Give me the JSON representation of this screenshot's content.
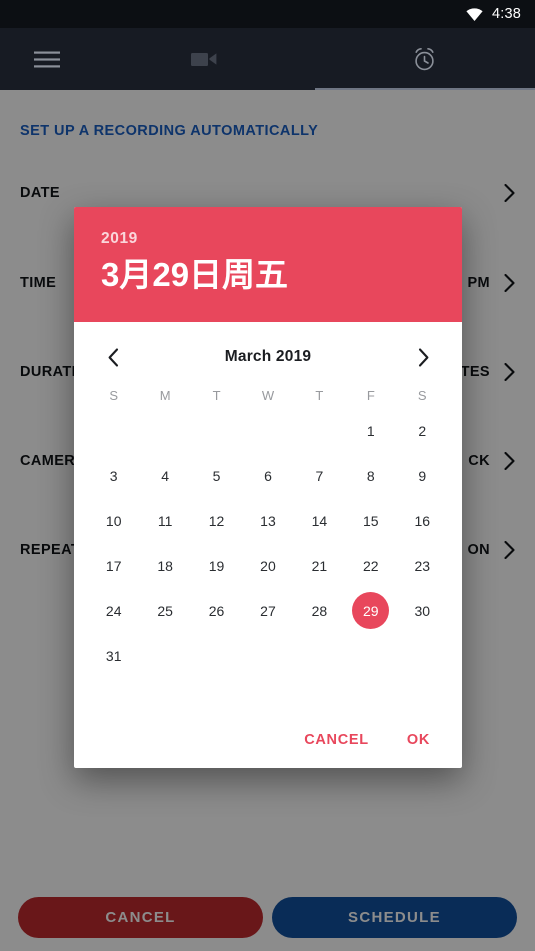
{
  "status_bar": {
    "time": "4:38",
    "wifi_icon": "wifi-icon"
  },
  "app_bar": {
    "menu_icon": "hamburger-menu-icon",
    "tabs": [
      {
        "icon": "video-camera-icon",
        "name": "tab-video",
        "active": false
      },
      {
        "icon": "alarm-clock-icon",
        "name": "tab-scheduler",
        "active": true
      }
    ]
  },
  "content": {
    "section_header": "SET UP A RECORDING AUTOMATICALLY",
    "rows": [
      {
        "label": "DATE",
        "value": "",
        "chevron": "chevron-right-icon"
      },
      {
        "label": "TIME",
        "value": "PM",
        "chevron": "chevron-right-icon"
      },
      {
        "label": "DURATION",
        "value": "TES",
        "chevron": "chevron-right-icon"
      },
      {
        "label": "CAMERA",
        "value": "CK",
        "chevron": "chevron-right-icon"
      },
      {
        "label": "REPEAT",
        "value": "ON",
        "chevron": "chevron-right-icon"
      }
    ],
    "bottom_buttons": {
      "cancel": "CANCEL",
      "schedule": "SCHEDULE"
    }
  },
  "dialog": {
    "header": {
      "year": "2019",
      "date_text": "3月29日周五"
    },
    "calendar": {
      "month_label": "March 2019",
      "prev_icon": "chevron-left-icon",
      "next_icon": "chevron-right-icon",
      "weekday_headers": [
        "S",
        "M",
        "T",
        "W",
        "T",
        "F",
        "S"
      ],
      "selected_day": 29,
      "weeks": [
        [
          "",
          "",
          "",
          "",
          "",
          "1",
          "2"
        ],
        [
          "3",
          "4",
          "5",
          "6",
          "7",
          "8",
          "9"
        ],
        [
          "10",
          "11",
          "12",
          "13",
          "14",
          "15",
          "16"
        ],
        [
          "17",
          "18",
          "19",
          "20",
          "21",
          "22",
          "23"
        ],
        [
          "24",
          "25",
          "26",
          "27",
          "28",
          "29",
          "30"
        ],
        [
          "31",
          "",
          "",
          "",
          "",
          "",
          ""
        ]
      ]
    },
    "actions": {
      "cancel": "CANCEL",
      "ok": "OK"
    }
  },
  "colors": {
    "accent_red": "#e8475c",
    "section_blue": "#1a5fc4",
    "cancel_pill": "#c02a2f",
    "schedule_pill": "#12509e",
    "status_bar": "#0c0f13",
    "app_bar": "#171b23"
  }
}
